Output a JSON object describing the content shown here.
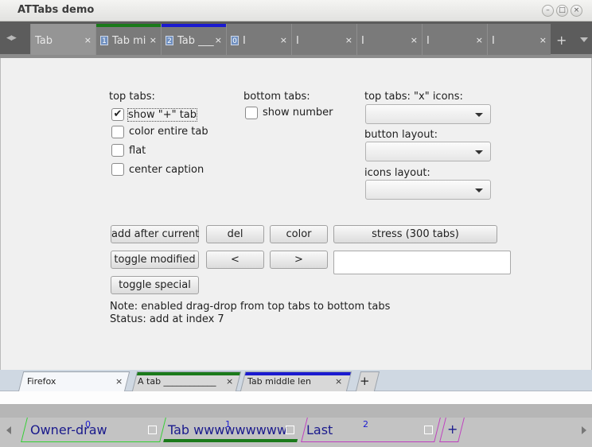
{
  "window": {
    "title": "ATTabs demo"
  },
  "top_tabs": {
    "items": [
      {
        "caption": "Tab",
        "close": "×"
      },
      {
        "number": "1",
        "caption": "Tab mi",
        "close": "×"
      },
      {
        "number": "2",
        "caption": "Tab ___",
        "close": "×"
      },
      {
        "number": "0",
        "caption": "I",
        "close": "×"
      },
      {
        "caption": "I",
        "close": "×"
      },
      {
        "caption": "I",
        "close": "×"
      },
      {
        "caption": "I",
        "close": "×"
      },
      {
        "caption": "I",
        "close": "×"
      }
    ],
    "plus": "+"
  },
  "options": {
    "top_tabs_heading": "top tabs:",
    "show_plus_tab": "show \"+\" tab",
    "show_plus_checked_mark": "✔",
    "color_entire_tab": "color entire tab",
    "flat": "flat",
    "center_caption": "center caption",
    "bottom_tabs_heading": "bottom tabs:",
    "show_number": "show number",
    "x_icons_label": "top tabs: \"x\" icons:",
    "button_layout_label": "button layout:",
    "icons_layout_label": "icons layout:"
  },
  "buttons": {
    "add_after_current": "add after current",
    "del": "del",
    "color": "color",
    "stress": "stress (300 tabs)",
    "toggle_modified": "toggle modified",
    "prev": "<",
    "next": ">",
    "toggle_special": "toggle special"
  },
  "notes": {
    "note": "Note: enabled drag-drop from top tabs to bottom tabs",
    "status": "Status: add at index 7"
  },
  "bottom_tabs": {
    "items": [
      {
        "caption": "Firefox",
        "close": "×"
      },
      {
        "caption": "A tab ____________",
        "close": "×"
      },
      {
        "caption": "Tab middle len",
        "close": "×"
      }
    ],
    "plus": "+"
  },
  "owner_draw_tabs": {
    "items": [
      {
        "caption": "Owner-draw",
        "number": "0"
      },
      {
        "caption": "Tab wwwwwwwww",
        "number": "1"
      },
      {
        "caption": "Last",
        "number": "2"
      }
    ],
    "plus": "+"
  },
  "colors": {
    "tab_green": "#1a7a1a",
    "tab_blue": "#1a1ad0",
    "owner_green": "#34d034",
    "owner_magenta": "#c040c0",
    "owner_text": "#1a1a8c"
  }
}
